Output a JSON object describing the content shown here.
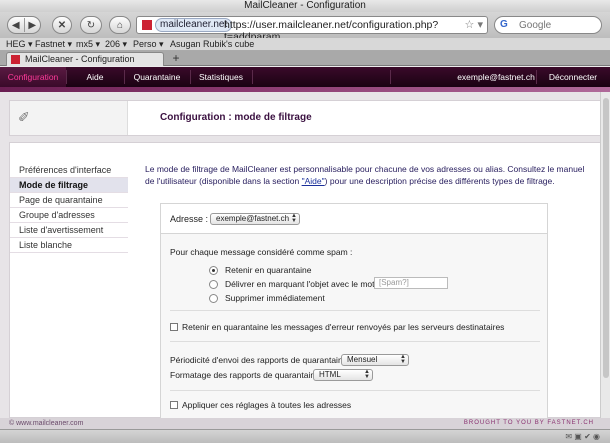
{
  "window": {
    "title": "MailCleaner - Configuration"
  },
  "toolbar": {
    "back_icon": "◀",
    "forward_icon": "▶",
    "stop_icon": "✕",
    "reload_icon": "↻",
    "home_icon": "⌂",
    "site_identity": "mailcleaner.net",
    "url": "https://user.mailcleaner.net/configuration.php?t=addparam",
    "url_icons": "☆ ▾",
    "search_engine_icon": "G",
    "search_placeholder": "Google"
  },
  "bookmarks": [
    {
      "label": "HEG ▾"
    },
    {
      "label": "Fastnet ▾"
    },
    {
      "label": "mx5 ▾"
    },
    {
      "label": "206 ▾"
    },
    {
      "label": "Perso ▾"
    },
    {
      "label": "Asugan Rubik's cube"
    }
  ],
  "tabs": [
    {
      "label": "MailCleaner - Configuration"
    }
  ],
  "newtab_label": "+",
  "appnav": {
    "items": [
      {
        "label": "Configuration",
        "active": true
      },
      {
        "label": "Aide"
      },
      {
        "label": "Quarantaine"
      },
      {
        "label": "Statistiques"
      }
    ],
    "user": "exemple@fastnet.ch",
    "logout": "Déconnecter"
  },
  "header": {
    "icon": "✐",
    "title": "Configuration : mode de filtrage"
  },
  "sidebar": {
    "items": [
      {
        "label": "Préférences d'interface"
      },
      {
        "label": "Mode de filtrage",
        "active": true
      },
      {
        "label": "Page de quarantaine"
      },
      {
        "label": "Groupe d'adresses"
      },
      {
        "label": "Liste d'avertissement"
      },
      {
        "label": "Liste blanche"
      }
    ]
  },
  "intro": {
    "text_before": "Le mode de filtrage de MailCleaner est personnalisable pour chacune de vos adresses ou alias. Consultez le manuel de l'utilisateur (disponible dans la section ",
    "link": "\"Aide\"",
    "text_after": ") pour une description précise des différents types de filtrage."
  },
  "form": {
    "address_label": "Adresse :",
    "address_value": "exemple@fastnet.ch",
    "spam_question": "Pour chaque message considéré comme spam :",
    "options": [
      {
        "label": "Retenir en quarantaine",
        "selected": true
      },
      {
        "label": "Délivrer en marquant l'objet avec le mot-clé :",
        "selected": false
      },
      {
        "label": "Supprimer immédiatement",
        "selected": false
      }
    ],
    "tag_placeholder": "[Spam?]",
    "retain_errors_label": "Retenir en quarantaine les messages d'erreur renvoyés par les serveurs destinataires",
    "period_label": "Périodicité d'envoi des rapports de quarantaine :",
    "period_value": "Mensuel",
    "format_label": "Formatage des rapports de quarantaine :",
    "format_value": "HTML",
    "apply_all_label": "Appliquer ces réglages à toutes les adresses"
  },
  "footer": {
    "left": "© www.mailcleaner.com",
    "right": "BROUGHT TO YOU BY FASTNET.CH"
  },
  "status_icons": "✉ ▣ ✔ ◉"
}
